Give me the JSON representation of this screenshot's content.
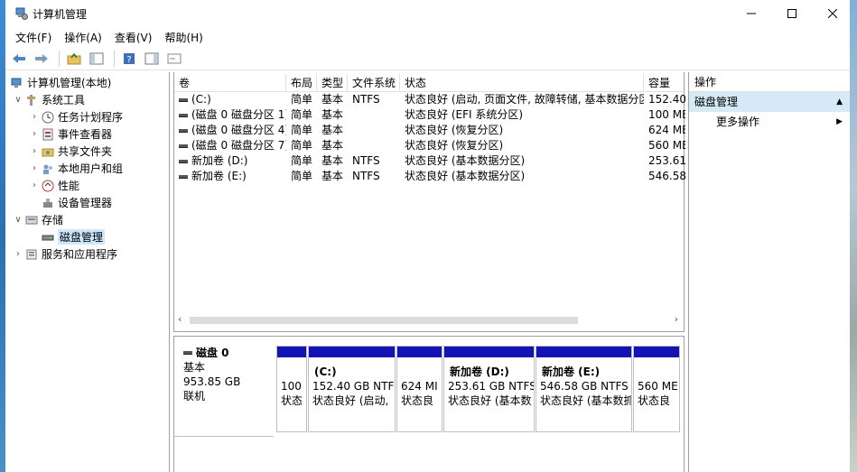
{
  "window": {
    "title": "计算机管理"
  },
  "menu": [
    "文件(F)",
    "操作(A)",
    "查看(V)",
    "帮助(H)"
  ],
  "tree": {
    "root": "计算机管理(本地)",
    "system_tools": "系统工具",
    "task_scheduler": "任务计划程序",
    "event_viewer": "事件查看器",
    "shared_folders": "共享文件夹",
    "local_users": "本地用户和组",
    "performance": "性能",
    "device_manager": "设备管理器",
    "storage": "存储",
    "disk_management": "磁盘管理",
    "services_apps": "服务和应用程序"
  },
  "list": {
    "columns": [
      "卷",
      "布局",
      "类型",
      "文件系统",
      "状态",
      "容量"
    ],
    "rows": [
      {
        "volume": "(C:)",
        "layout": "简单",
        "type": "基本",
        "fs": "NTFS",
        "status": "状态良好 (启动, 页面文件, 故障转储, 基本数据分区)",
        "capacity": "152.40"
      },
      {
        "volume": "(磁盘 0 磁盘分区 1)",
        "layout": "简单",
        "type": "基本",
        "fs": "",
        "status": "状态良好 (EFI 系统分区)",
        "capacity": "100 ME"
      },
      {
        "volume": "(磁盘 0 磁盘分区 4)",
        "layout": "简单",
        "type": "基本",
        "fs": "",
        "status": "状态良好 (恢复分区)",
        "capacity": "624 ME"
      },
      {
        "volume": "(磁盘 0 磁盘分区 7)",
        "layout": "简单",
        "type": "基本",
        "fs": "",
        "status": "状态良好 (恢复分区)",
        "capacity": "560 ME"
      },
      {
        "volume": "新加卷 (D:)",
        "layout": "简单",
        "type": "基本",
        "fs": "NTFS",
        "status": "状态良好 (基本数据分区)",
        "capacity": "253.61"
      },
      {
        "volume": "新加卷 (E:)",
        "layout": "简单",
        "type": "基本",
        "fs": "NTFS",
        "status": "状态良好 (基本数据分区)",
        "capacity": "546.58"
      }
    ]
  },
  "disk": {
    "name": "磁盘 0",
    "type": "基本",
    "size": "953.85 GB",
    "state": "联机",
    "partitions": [
      {
        "name": "",
        "size": "100",
        "status": "状态"
      },
      {
        "name": "(C:)",
        "size": "152.40 GB NTF",
        "status": "状态良好 (启动,"
      },
      {
        "name": "",
        "size": "624 MI",
        "status": "状态良"
      },
      {
        "name": "新加卷  (D:)",
        "size": "253.61 GB NTFS",
        "status": "状态良好 (基本数"
      },
      {
        "name": "新加卷  (E:)",
        "size": "546.58 GB NTFS",
        "status": "状态良好 (基本数抓"
      },
      {
        "name": "",
        "size": "560 ME",
        "status": "状态良"
      }
    ]
  },
  "actions": {
    "header": "操作",
    "section": "磁盘管理",
    "more": "更多操作"
  },
  "colors": {
    "partition_bar": "#1414b4",
    "selection": "#cce8ff",
    "action_section": "#d6e9f7"
  }
}
